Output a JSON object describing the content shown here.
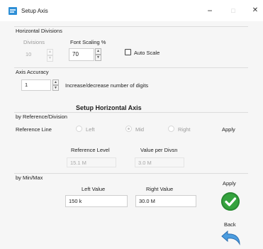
{
  "window": {
    "title": "Setup Axis",
    "minimize_glyph": "−",
    "maximize_glyph": "□",
    "close_glyph": "✕"
  },
  "horizontal_divisions": {
    "group_label": "Horizontal Divisions",
    "divisions_label": "Divisions",
    "divisions_value": "10",
    "font_scaling_label": "Font Scaling %",
    "font_scaling_value": "70",
    "auto_scale_label": "Auto Scale",
    "auto_scale_checked": false
  },
  "axis_accuracy": {
    "group_label": "Axis Accuracy",
    "value": "1",
    "hint": "Increase/decrease number of digits"
  },
  "setup_heading": "Setup Horizontal Axis",
  "by_reference": {
    "group_label": "by Reference/Division",
    "reference_line_label": "Reference Line",
    "options": [
      "Left",
      "Mid",
      "Right"
    ],
    "selected": "Mid",
    "apply_label": "Apply",
    "reference_level_label": "Reference Level",
    "reference_level_value": "15.1 M",
    "value_per_division_label": "Value per Divsn",
    "value_per_division_value": "3.0 M"
  },
  "by_minmax": {
    "group_label": "by Min/Max",
    "left_value_label": "Left Value",
    "left_value": "150 k",
    "right_value_label": "Right Value",
    "right_value": "30.0 M",
    "apply_label": "Apply"
  },
  "back_label": "Back",
  "colors": {
    "accent": "#2e8fd6",
    "apply_green": "#35a33e"
  },
  "icons": {
    "app": "window-app-icon",
    "apply": "check-circle-icon",
    "back": "undo-arrow-icon"
  }
}
